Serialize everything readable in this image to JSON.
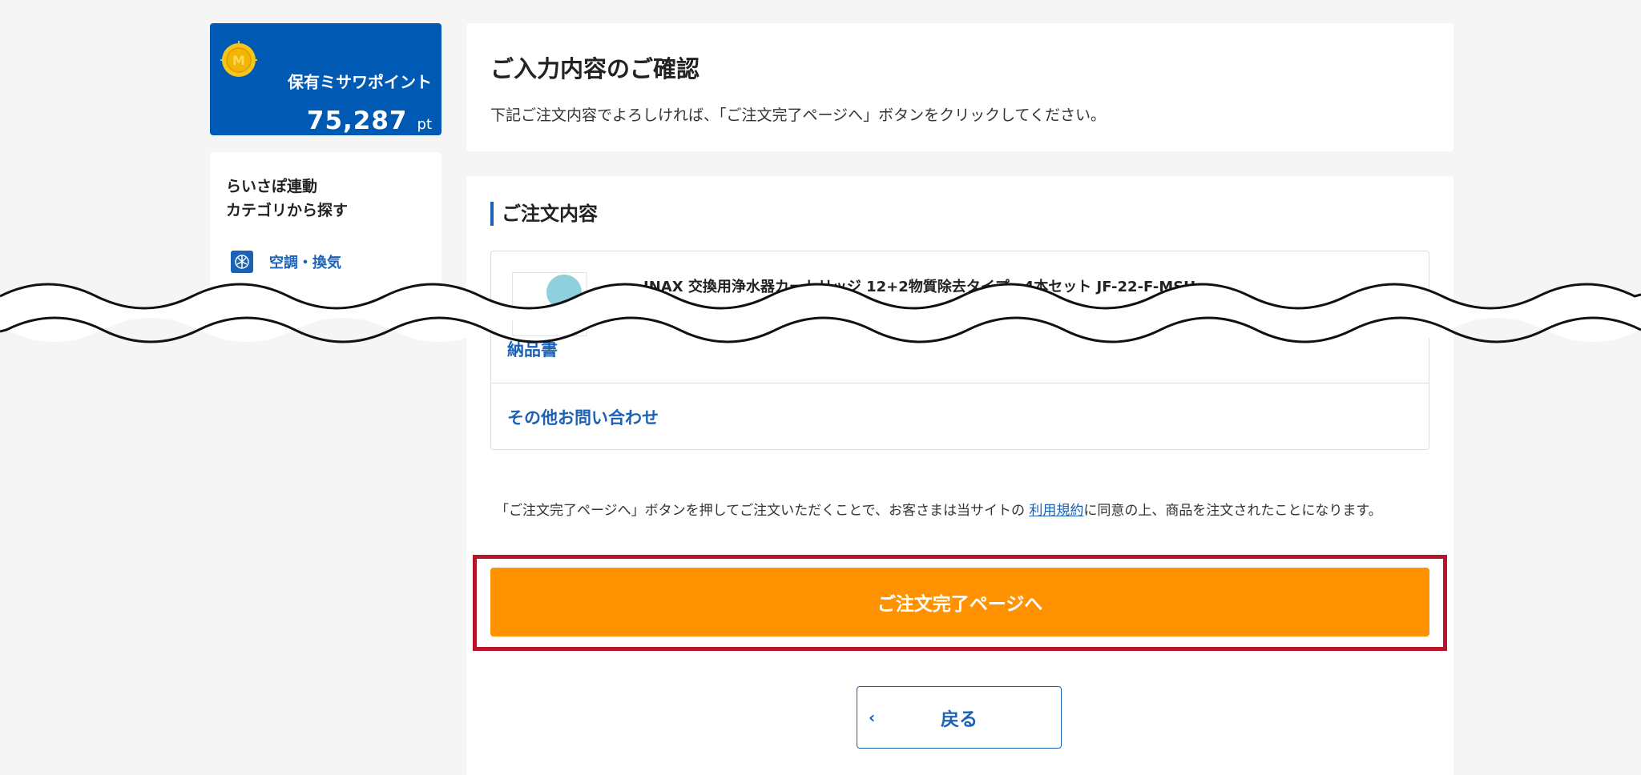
{
  "sidebar": {
    "points": {
      "title": "保有ミサワポイント",
      "value": "75,287",
      "unit": "pt",
      "coin_icon": "coin-m-icon"
    },
    "category": {
      "heading_line1": "らいさぽ連動",
      "heading_line2": "カテゴリから探す",
      "items": [
        {
          "label": "空調・換気",
          "icon": "fan-icon"
        }
      ]
    }
  },
  "confirm": {
    "title": "ご入力内容のご確認",
    "description": "下記ご注文内容でよろしければ、「ご注文完了ページへ」ボタンをクリックしてください。"
  },
  "order": {
    "heading": "ご注文内容",
    "product_name": "INAX 交換用浄水器カートリッジ 12+2物質除去タイプ　4本セット JF-22-F-MSH",
    "links": {
      "delivery_slip": "納品書",
      "other_inquiry": "その他お問い合わせ"
    },
    "terms_prefix": "「ご注文完了ページへ」ボタンを押してご注文いただくことで、お客さまは当サイトの",
    "terms_link": "利用規約",
    "terms_suffix": "に同意の上、商品を注文されたことになります。",
    "complete_button": "ご注文完了ページへ",
    "back_button": "戻る",
    "back_chevron": "‹"
  },
  "colors": {
    "brand_blue": "#005ab4",
    "link_blue": "#1b62b4",
    "accent_orange": "#ff9200",
    "highlight_red": "#b5162a"
  }
}
